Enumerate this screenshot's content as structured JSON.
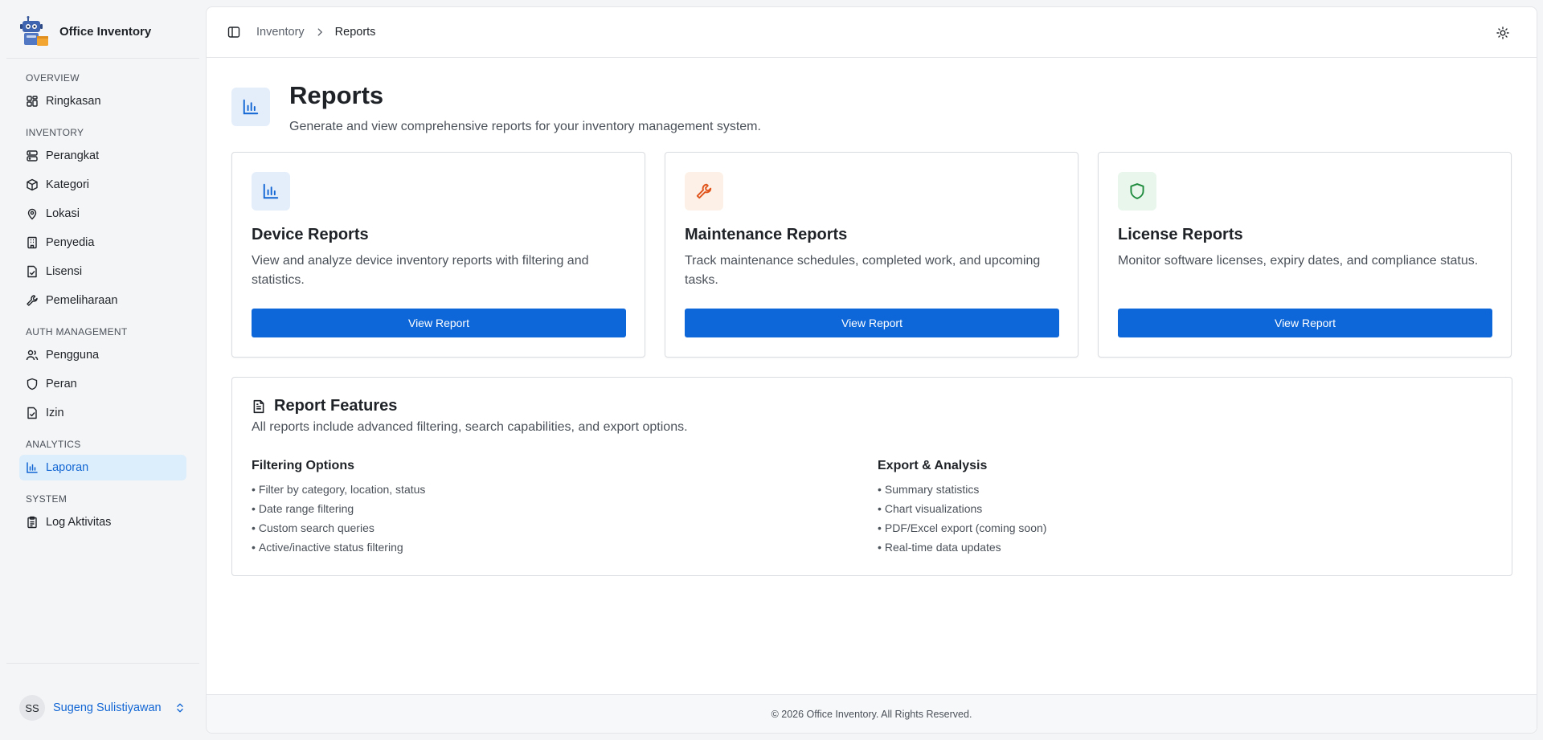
{
  "app": {
    "name": "Office Inventory",
    "logo_icon": "robot-box-logo"
  },
  "sidebar": {
    "sections": [
      {
        "heading": "Overview",
        "items": [
          {
            "label": "Ringkasan",
            "icon": "dashboard-icon"
          }
        ]
      },
      {
        "heading": "Inventory",
        "items": [
          {
            "label": "Perangkat",
            "icon": "server-icon"
          },
          {
            "label": "Kategori",
            "icon": "package-icon"
          },
          {
            "label": "Lokasi",
            "icon": "map-pin-icon"
          },
          {
            "label": "Penyedia",
            "icon": "building-icon"
          },
          {
            "label": "Lisensi",
            "icon": "file-check-icon"
          },
          {
            "label": "Pemeliharaan",
            "icon": "wrench-icon"
          }
        ]
      },
      {
        "heading": "Auth Management",
        "items": [
          {
            "label": "Pengguna",
            "icon": "users-icon"
          },
          {
            "label": "Peran",
            "icon": "shield-icon"
          },
          {
            "label": "Izin",
            "icon": "file-check-icon"
          }
        ]
      },
      {
        "heading": "Analytics",
        "items": [
          {
            "label": "Laporan",
            "icon": "bar-chart-icon",
            "active": true
          }
        ]
      },
      {
        "heading": "System",
        "items": [
          {
            "label": "Log Aktivitas",
            "icon": "clipboard-icon"
          }
        ]
      }
    ]
  },
  "user": {
    "initials": "SS",
    "name": "Sugeng Sulistiyawan"
  },
  "breadcrumb": {
    "parent": "Inventory",
    "current": "Reports"
  },
  "page": {
    "title": "Reports",
    "subtitle": "Generate and view comprehensive reports for your inventory management system."
  },
  "cards": [
    {
      "title": "Device Reports",
      "description": "View and analyze device inventory reports with filtering and statistics.",
      "button": "View Report",
      "icon": "bar-chart-icon",
      "icon_bg": "#e4eefb",
      "icon_color": "#1266d4"
    },
    {
      "title": "Maintenance Reports",
      "description": "Track maintenance schedules, completed work, and upcoming tasks.",
      "button": "View Report",
      "icon": "wrench-icon",
      "icon_bg": "#fdf1e7",
      "icon_color": "#e0541b"
    },
    {
      "title": "License Reports",
      "description": "Monitor software licenses, expiry dates, and compliance status.",
      "button": "View Report",
      "icon": "shield-icon",
      "icon_bg": "#e8f6ec",
      "icon_color": "#1d8a3c"
    }
  ],
  "features": {
    "title": "Report Features",
    "description": "All reports include advanced filtering, search capabilities, and export options.",
    "columns": [
      {
        "heading": "Filtering Options",
        "items": [
          "Filter by category, location, status",
          "Date range filtering",
          "Custom search queries",
          "Active/inactive status filtering"
        ]
      },
      {
        "heading": "Export & Analysis",
        "items": [
          "Summary statistics",
          "Chart visualizations",
          "PDF/Excel export (coming soon)",
          "Real-time data updates"
        ]
      }
    ]
  },
  "footer": {
    "text": "© 2026 Office Inventory. All Rights Reserved."
  },
  "colors": {
    "primary": "#0e67d8",
    "active_bg": "#dceefb"
  }
}
